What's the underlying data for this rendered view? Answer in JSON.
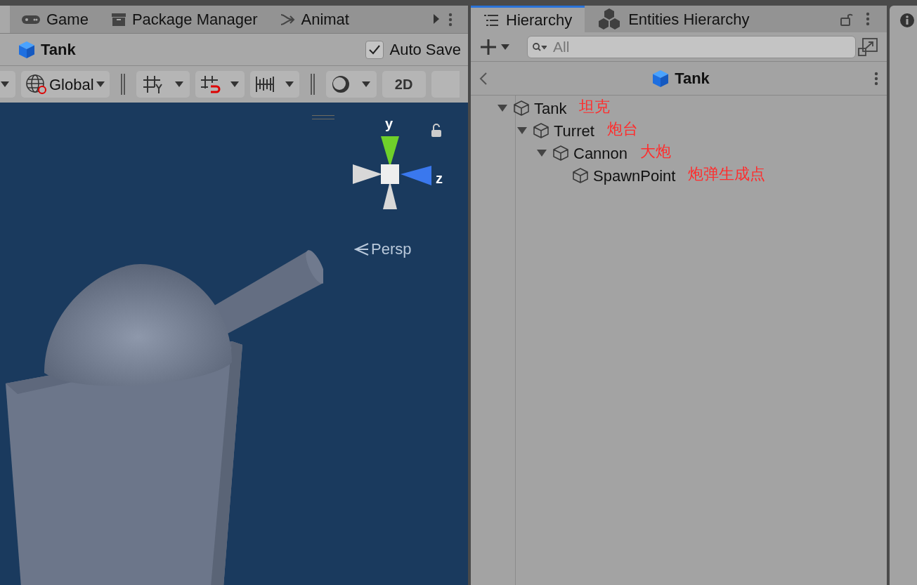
{
  "scene_panel": {
    "tabs": [
      {
        "label": "Game",
        "selected": false
      },
      {
        "label": "Package Manager",
        "selected": false
      },
      {
        "label": "Animat",
        "selected": false
      }
    ],
    "breadcrumb": {
      "title": "Tank"
    },
    "auto_save": {
      "label": "Auto Save",
      "checked": true
    },
    "toolbar": {
      "pivot_label": "Global",
      "mode_label": "2D"
    },
    "gizmo": {
      "y_label": "y",
      "z_label": "z",
      "view_label": "Persp"
    }
  },
  "hierarchy_panel": {
    "tabs": [
      {
        "label": "Hierarchy",
        "selected": true
      },
      {
        "label": "Entities Hierarchy",
        "selected": false
      }
    ],
    "search": {
      "placeholder": "All"
    },
    "header": {
      "title": "Tank"
    },
    "tree": [
      {
        "name": "Tank",
        "note": "坦克",
        "expanded": true,
        "children": [
          {
            "name": "Turret",
            "note": "炮台",
            "expanded": true,
            "children": [
              {
                "name": "Cannon",
                "note": "大炮",
                "expanded": true,
                "children": [
                  {
                    "name": "SpawnPoint",
                    "note": "炮弹生成点"
                  }
                ]
              }
            ]
          }
        ]
      }
    ]
  }
}
